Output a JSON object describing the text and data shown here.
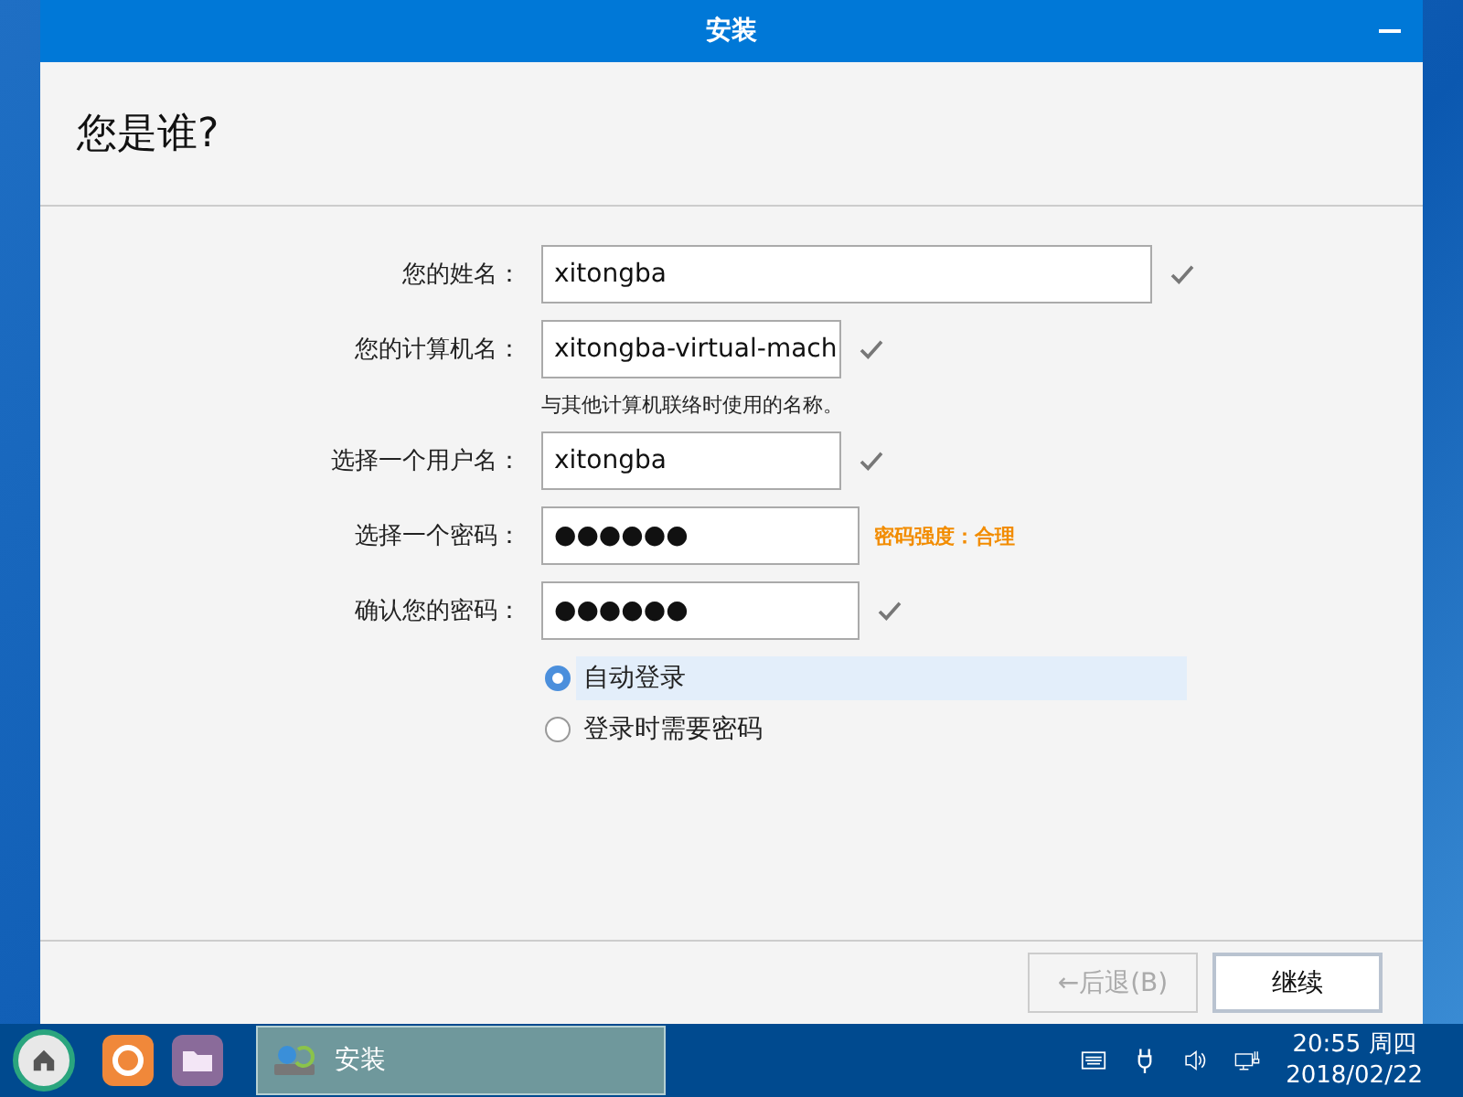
{
  "window": {
    "title": "安装"
  },
  "heading": "您是谁?",
  "fields": [
    {
      "label": "您的姓名：",
      "value": "xitongba",
      "valid": true
    },
    {
      "label": "您的计算机名：",
      "value": "xitongba-virtual-mach",
      "valid": true,
      "hint": "与其他计算机联络时使用的名称。"
    },
    {
      "label": "选择一个用户名：",
      "value": "xitongba",
      "valid": true
    },
    {
      "label": "选择一个密码：",
      "value": "●●●●●●",
      "valid": false,
      "strength": "密码强度：合理"
    },
    {
      "label": "确认您的密码：",
      "value": "●●●●●●",
      "valid": true
    }
  ],
  "login_options": [
    {
      "label": "自动登录",
      "selected": true
    },
    {
      "label": "登录时需要密码",
      "selected": false
    }
  ],
  "buttons": [
    {
      "label": "←后退(B)",
      "disabled": true
    },
    {
      "label": "继续",
      "disabled": false
    }
  ],
  "taskbar": {
    "task": "安装",
    "clock_time": "20:55 周四",
    "clock_date": "2018/02/22"
  }
}
